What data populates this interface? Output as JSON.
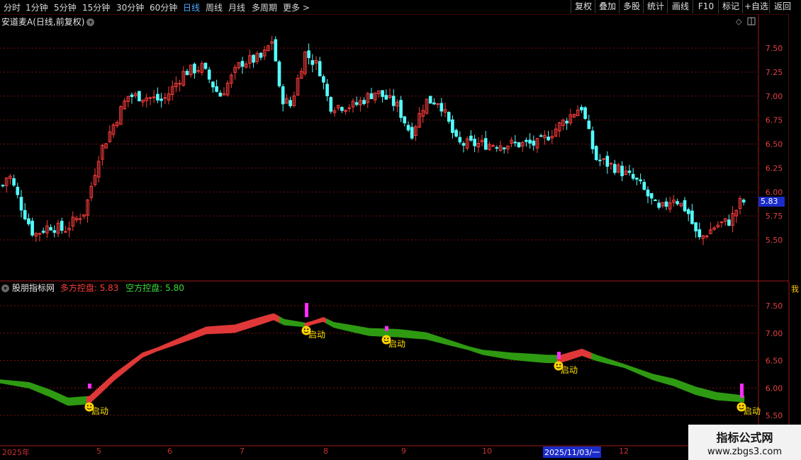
{
  "toolbar": {
    "periods": [
      "分时",
      "1分钟",
      "5分钟",
      "15分钟",
      "30分钟",
      "60分钟",
      "日线",
      "周线",
      "月线",
      "多周期",
      "更多 >"
    ],
    "active_period": "日线",
    "right_buttons": [
      "复权",
      "叠加",
      "多股",
      "统计",
      "画线",
      "F10",
      "标记",
      "+自选",
      "返回"
    ]
  },
  "main_chart": {
    "title": "安道麦A(日线,前复权)",
    "y_ticks": [
      "7.50",
      "7.25",
      "7.00",
      "6.75",
      "6.50",
      "6.25",
      "6.00",
      "5.75",
      "5.50"
    ],
    "current_price": "5.83"
  },
  "indicator": {
    "name": "股朋指标网",
    "long_label": "多方控盘:",
    "long_value": "5.83",
    "short_label": "空方控盘:",
    "short_value": "5.80",
    "y_ticks": [
      "7.50",
      "7.00",
      "6.50",
      "6.00",
      "5.50"
    ],
    "signal_label": "启动"
  },
  "date_axis": {
    "labels": [
      "2025年",
      "5",
      "6",
      "7",
      "8",
      "9",
      "10",
      "2025/11/03/一",
      "12"
    ]
  },
  "right_strip_text": "我",
  "watermark": {
    "line1": "指标公式网",
    "line2": "www.zbgs3.com"
  },
  "colors": {
    "up": "#ff3c3c",
    "down": "#54ffff",
    "long_band": "#e03838",
    "short_band": "#2e9a12",
    "grid": "#7a1010",
    "marker": "#ff2dff"
  }
}
